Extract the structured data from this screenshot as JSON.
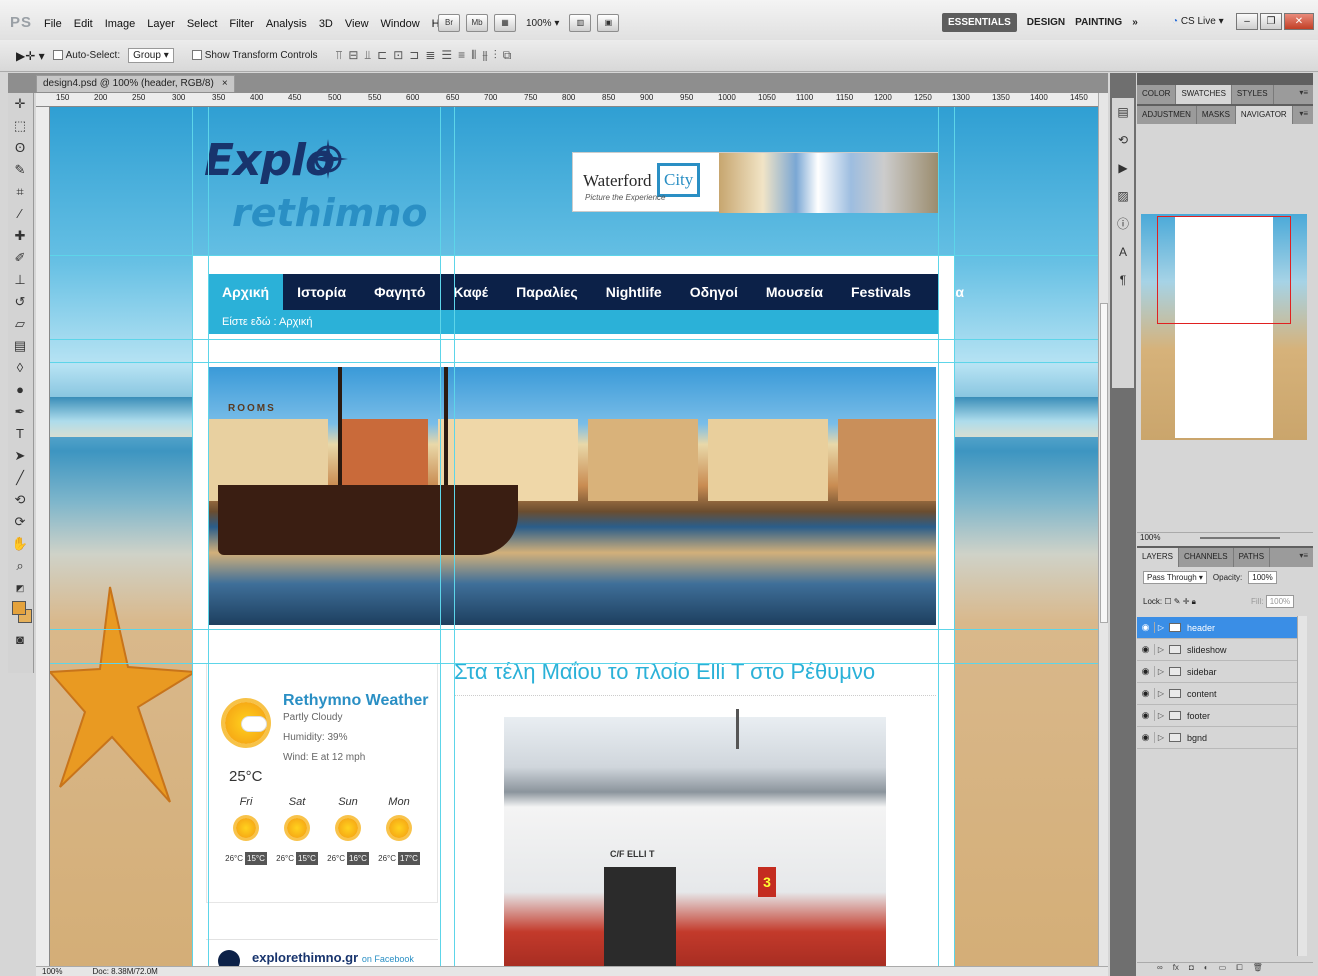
{
  "app": {
    "logo": "PS"
  },
  "menu": [
    "File",
    "Edit",
    "Image",
    "Layer",
    "Select",
    "Filter",
    "Analysis",
    "3D",
    "View",
    "Window",
    "Help"
  ],
  "quick": {
    "br": "Br",
    "mb": "Mb",
    "zoom": "100%"
  },
  "workspaces": {
    "active": "ESSENTIALS",
    "design": "DESIGN",
    "painting": "PAINTING",
    "more": "»",
    "cslive": "CS Live"
  },
  "options": {
    "auto_select_label": "Auto-Select:",
    "auto_select_value": "Group",
    "transform_label": "Show Transform Controls"
  },
  "document": {
    "tab_title": "design4.psd @ 100% (header, RGB/8)",
    "close": "×"
  },
  "ruler": {
    "labels": [
      "150",
      "200",
      "250",
      "300",
      "350",
      "400",
      "450",
      "500",
      "550",
      "600",
      "650",
      "700",
      "750",
      "800",
      "850",
      "900",
      "950",
      "1000",
      "1050",
      "1100",
      "1150",
      "1200",
      "1250",
      "1300",
      "1350",
      "1400",
      "1450"
    ]
  },
  "site": {
    "logo_top": "Explo",
    "logo_bottom": "rethimno",
    "ad": {
      "word": "Waterford",
      "city": "City",
      "tagline": "Picture the Experience"
    },
    "nav": [
      "Αρχική",
      "Ιστορία",
      "Φαγητό",
      "Καφέ",
      "Παραλίες",
      "Nightlife",
      "Οδηγοί",
      "Μουσεία",
      "Festivals",
      "Νέα"
    ],
    "breadcrumb": "Είστε εδώ : Αρχική",
    "weather": {
      "title": "Rethymno Weather",
      "condition": "Partly Cloudy",
      "humidity": "Humidity: 39%",
      "wind": "Wind: E at 12 mph",
      "temp": "25°C",
      "forecast": [
        {
          "day": "Fri",
          "hi": "26°C",
          "lo": "15°C"
        },
        {
          "day": "Sat",
          "hi": "26°C",
          "lo": "15°C"
        },
        {
          "day": "Sun",
          "hi": "26°C",
          "lo": "16°C"
        },
        {
          "day": "Mon",
          "hi": "26°C",
          "lo": "17°C"
        }
      ]
    },
    "facebook": {
      "title": "explorethimno.gr",
      "sub": "on Facebook"
    },
    "article_title": "Στα τέλη Μαΐου το πλοίο Elli T στο Ρέθυμνο",
    "ship": {
      "name": "C/F ELLI T",
      "number": "3"
    },
    "slide_sign": "ROOMS"
  },
  "status": {
    "zoom": "100%",
    "doc": "Doc: 8.38M/72.0M"
  },
  "panels": {
    "tabs1": [
      "COLOR",
      "SWATCHES",
      "STYLES"
    ],
    "tabs2": [
      "ADJUSTMEN",
      "MASKS",
      "NAVIGATOR"
    ],
    "navigator_zoom": "100%",
    "tabs3": [
      "LAYERS",
      "CHANNELS",
      "PATHS"
    ],
    "blend_mode": "Pass Through",
    "opacity_label": "Opacity:",
    "opacity": "100%",
    "lock_label": "Lock:",
    "fill_label": "Fill:",
    "fill": "100%",
    "layers": [
      "header",
      "slideshow",
      "sidebar",
      "content",
      "footer",
      "bgnd"
    ]
  }
}
